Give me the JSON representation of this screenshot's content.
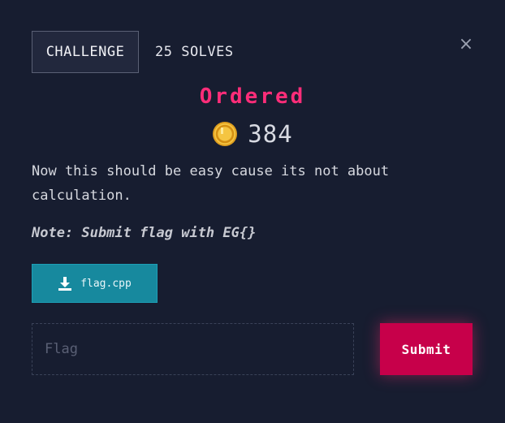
{
  "tabs": {
    "challenge_label": "CHALLENGE",
    "solves_label": "25 SOLVES"
  },
  "close_icon": "×",
  "challenge": {
    "name": "Ordered",
    "value": "384",
    "value_icon": "coin-icon",
    "description": "Now this should be easy cause its not about calculation.",
    "note": "Note: Submit flag with EG{}"
  },
  "file": {
    "name": "flag.cpp",
    "icon": "download-icon"
  },
  "flag_input": {
    "placeholder": "Flag",
    "value": ""
  },
  "submit_label": "Submit",
  "colors": {
    "background": "#171d30",
    "title": "#ff2d79",
    "file_button": "#17899e",
    "submit_button": "#c7004a",
    "coin": "#f5b82e"
  }
}
